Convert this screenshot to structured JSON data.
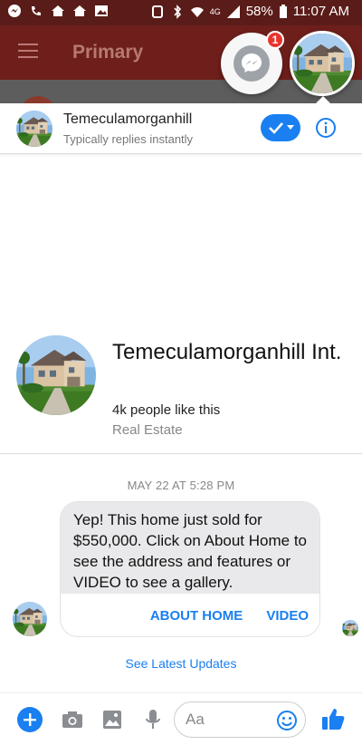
{
  "status_bar": {
    "battery": "58%",
    "time": "11:07 AM",
    "network": "4G"
  },
  "background_app": {
    "title": "Primary"
  },
  "chat_heads": {
    "badge_count": "1"
  },
  "conversation": {
    "name": "Temeculamorganhill",
    "subtitle": "Typically replies instantly"
  },
  "profile": {
    "name": "Temeculamorganhill Int.",
    "likes": "4k people like this",
    "category": "Real Estate"
  },
  "messages": {
    "timestamp": "MAY 22 AT 5:28 PM",
    "text": "Yep! This home just sold for $550,000. Click on About Home to see the address and features or VIDEO to see a gallery.",
    "buttons": [
      "ABOUT HOME",
      "VIDEO"
    ]
  },
  "see_latest": "See Latest Updates",
  "composer": {
    "placeholder": "Aa"
  },
  "colors": {
    "accent": "#1a7ff0",
    "badge": "#e8352e",
    "status_bar": "#5a1c18"
  }
}
